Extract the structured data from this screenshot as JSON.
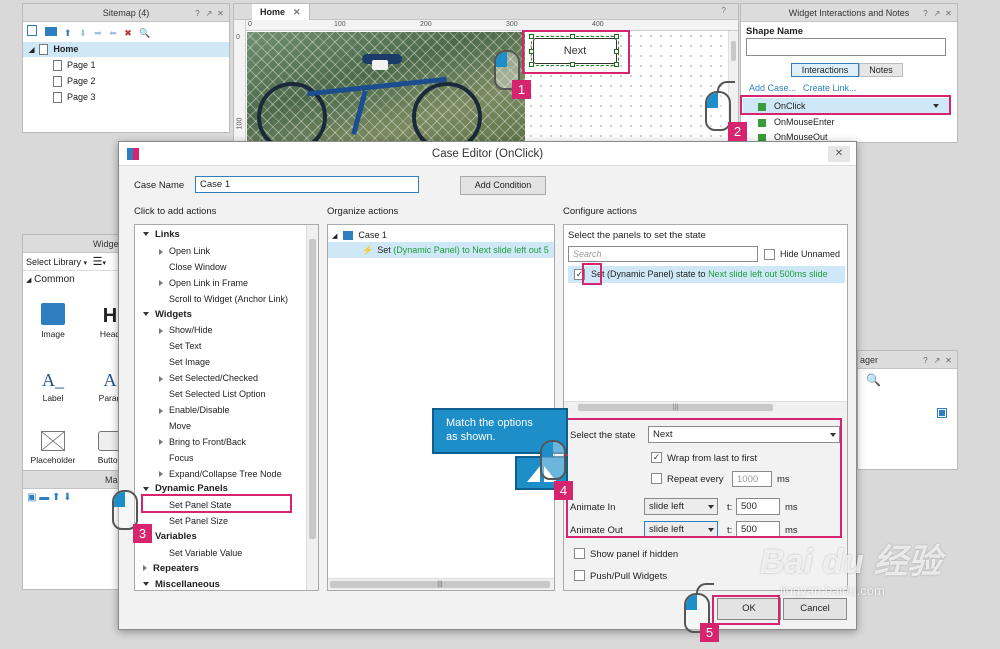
{
  "sitemap": {
    "title": "Sitemap (4)",
    "home": "Home",
    "pages": [
      "Page 1",
      "Page 2",
      "Page 3"
    ]
  },
  "canvas": {
    "tab": "Home",
    "ruler_top": [
      "0",
      "100",
      "200",
      "300",
      "400"
    ],
    "ruler_left": [
      "0",
      "100"
    ],
    "next_button": "Next"
  },
  "interactions_panel": {
    "title": "Widget Interactions and Notes",
    "shape_name_label": "Shape Name",
    "tab_interactions": "Interactions",
    "tab_notes": "Notes",
    "add_case": "Add Case...",
    "create_link": "Create Link...",
    "events": [
      "OnClick",
      "OnMouseEnter",
      "OnMouseOut"
    ]
  },
  "widgets_panel": {
    "title": "Widget",
    "select_library": "Select Library",
    "common": "Common",
    "items": [
      "Image",
      "Head",
      "Label",
      "Parag",
      "Placeholder",
      "Button"
    ],
    "masters": "Mas"
  },
  "manager_panel": {
    "title": "ager"
  },
  "case_editor": {
    "title": "Case Editor (OnClick)",
    "case_name_label": "Case Name",
    "case_name_value": "Case 1",
    "add_condition": "Add Condition",
    "col1_header": "Click to add actions",
    "col2_header": "Organize actions",
    "col3_header": "Configure actions",
    "actions": [
      {
        "label": "Links",
        "type": "cat"
      },
      {
        "label": "Open Link",
        "type": "item",
        "arrow": true
      },
      {
        "label": "Close Window",
        "type": "item"
      },
      {
        "label": "Open Link in Frame",
        "type": "item",
        "arrow": true
      },
      {
        "label": "Scroll to Widget (Anchor Link)",
        "type": "item"
      },
      {
        "label": "Widgets",
        "type": "cat"
      },
      {
        "label": "Show/Hide",
        "type": "item",
        "arrow": true
      },
      {
        "label": "Set Text",
        "type": "item"
      },
      {
        "label": "Set Image",
        "type": "item"
      },
      {
        "label": "Set Selected/Checked",
        "type": "item",
        "arrow": true
      },
      {
        "label": "Set Selected List Option",
        "type": "item"
      },
      {
        "label": "Enable/Disable",
        "type": "item",
        "arrow": true
      },
      {
        "label": "Move",
        "type": "item"
      },
      {
        "label": "Bring to Front/Back",
        "type": "item",
        "arrow": true
      },
      {
        "label": "Focus",
        "type": "item"
      },
      {
        "label": "Expand/Collapse Tree Node",
        "type": "item",
        "arrow": true
      },
      {
        "label": "Dynamic Panels",
        "type": "cat"
      },
      {
        "label": "Set Panel State",
        "type": "item"
      },
      {
        "label": "Set Panel Size",
        "type": "item"
      },
      {
        "label": "Variables",
        "type": "cat"
      },
      {
        "label": "Set Variable Value",
        "type": "item"
      },
      {
        "label": "Repeaters",
        "type": "cat",
        "collapsed": true
      },
      {
        "label": "Miscellaneous",
        "type": "cat"
      }
    ],
    "organize": {
      "case": "Case 1",
      "action_prefix": "Set ",
      "action_green": "(Dynamic Panel) to Next slide left out 5"
    },
    "configure": {
      "select_panels_label": "Select the panels to set the state",
      "search_placeholder": "Search",
      "hide_unnamed": "Hide Unnamed",
      "panel_row_prefix": "Set (Dynamic Panel) state to ",
      "panel_row_green": "Next slide left out 500ms slide",
      "select_state_label": "Select the state",
      "select_state_value": "Next",
      "wrap_label": "Wrap from last to first",
      "repeat_label": "Repeat every",
      "repeat_value": "1000",
      "ms": "ms",
      "animate_in_label": "Animate In",
      "animate_in_value": "slide left",
      "animate_out_label": "Animate Out",
      "animate_out_value": "slide left",
      "t_label": "t:",
      "in_duration": "500",
      "out_duration": "500",
      "show_panel_label": "Show panel if hidden",
      "push_pull_label": "Push/Pull Widgets"
    },
    "ok": "OK",
    "cancel": "Cancel"
  },
  "tooltip": {
    "line1": "Match the options",
    "line2": "as shown."
  },
  "callouts": [
    "1",
    "2",
    "3",
    "4",
    "5"
  ],
  "watermark": {
    "logo": "Bai du 经验",
    "url": "jingyan.baidu.com"
  },
  "colors": {
    "accent_pink": "#d6246e",
    "selection_blue": "#cfe8f7",
    "tooltip_blue": "#1e8ec9",
    "action_green": "#1f9e3a"
  }
}
